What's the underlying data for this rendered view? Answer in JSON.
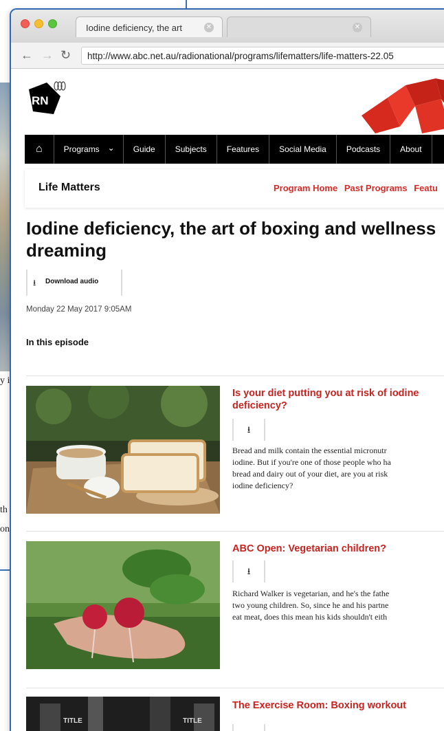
{
  "background": {
    "text_lines": [
      "y in",
      "th",
      "on"
    ]
  },
  "browser": {
    "tab_active_title": "Iodine deficiency, the art",
    "url": "http://www.abc.net.au/radionational/programs/lifematters/life-matters-22.05"
  },
  "site": {
    "logo_text": "RN",
    "nav_items": [
      "Programs",
      "Guide",
      "Subjects",
      "Features",
      "Social Media",
      "Podcasts",
      "About"
    ],
    "program_title": "Life Matters",
    "program_links": [
      "Program Home",
      "Past Programs",
      "Featu"
    ]
  },
  "episode": {
    "title": "Iodine deficiency, the art of boxing and wellness dreaming",
    "download_label": "Download audio",
    "date": "Monday 22 May 2017 9:05AM",
    "section_heading": "In this episode"
  },
  "segments": [
    {
      "title": "Is your diet putting you at risk of iodine deficiency?",
      "description_lines": [
        "Bread and milk contain the essential micronutr",
        "iodine. But if you're one of those people who ha",
        "bread and dairy out of your diet, are you at risk",
        "iodine deficiency?"
      ]
    },
    {
      "title": "ABC Open: Vegetarian children?",
      "description_lines": [
        "Richard Walker is vegetarian, and he's the fathe",
        "two young children. So, since he and his partne",
        "eat meat, does this mean his kids shouldn't eith"
      ]
    },
    {
      "title": "The Exercise Room: Boxing workout",
      "description_lines": []
    }
  ],
  "colors": {
    "accent_red": "#d62c28",
    "navbar_black": "#000000",
    "frame_blue": "#2e67b2"
  },
  "icons": [
    "home-icon",
    "chevron-down-icon",
    "download-icon",
    "back-arrow-icon",
    "forward-arrow-icon",
    "reload-icon",
    "tab-close-icon"
  ]
}
